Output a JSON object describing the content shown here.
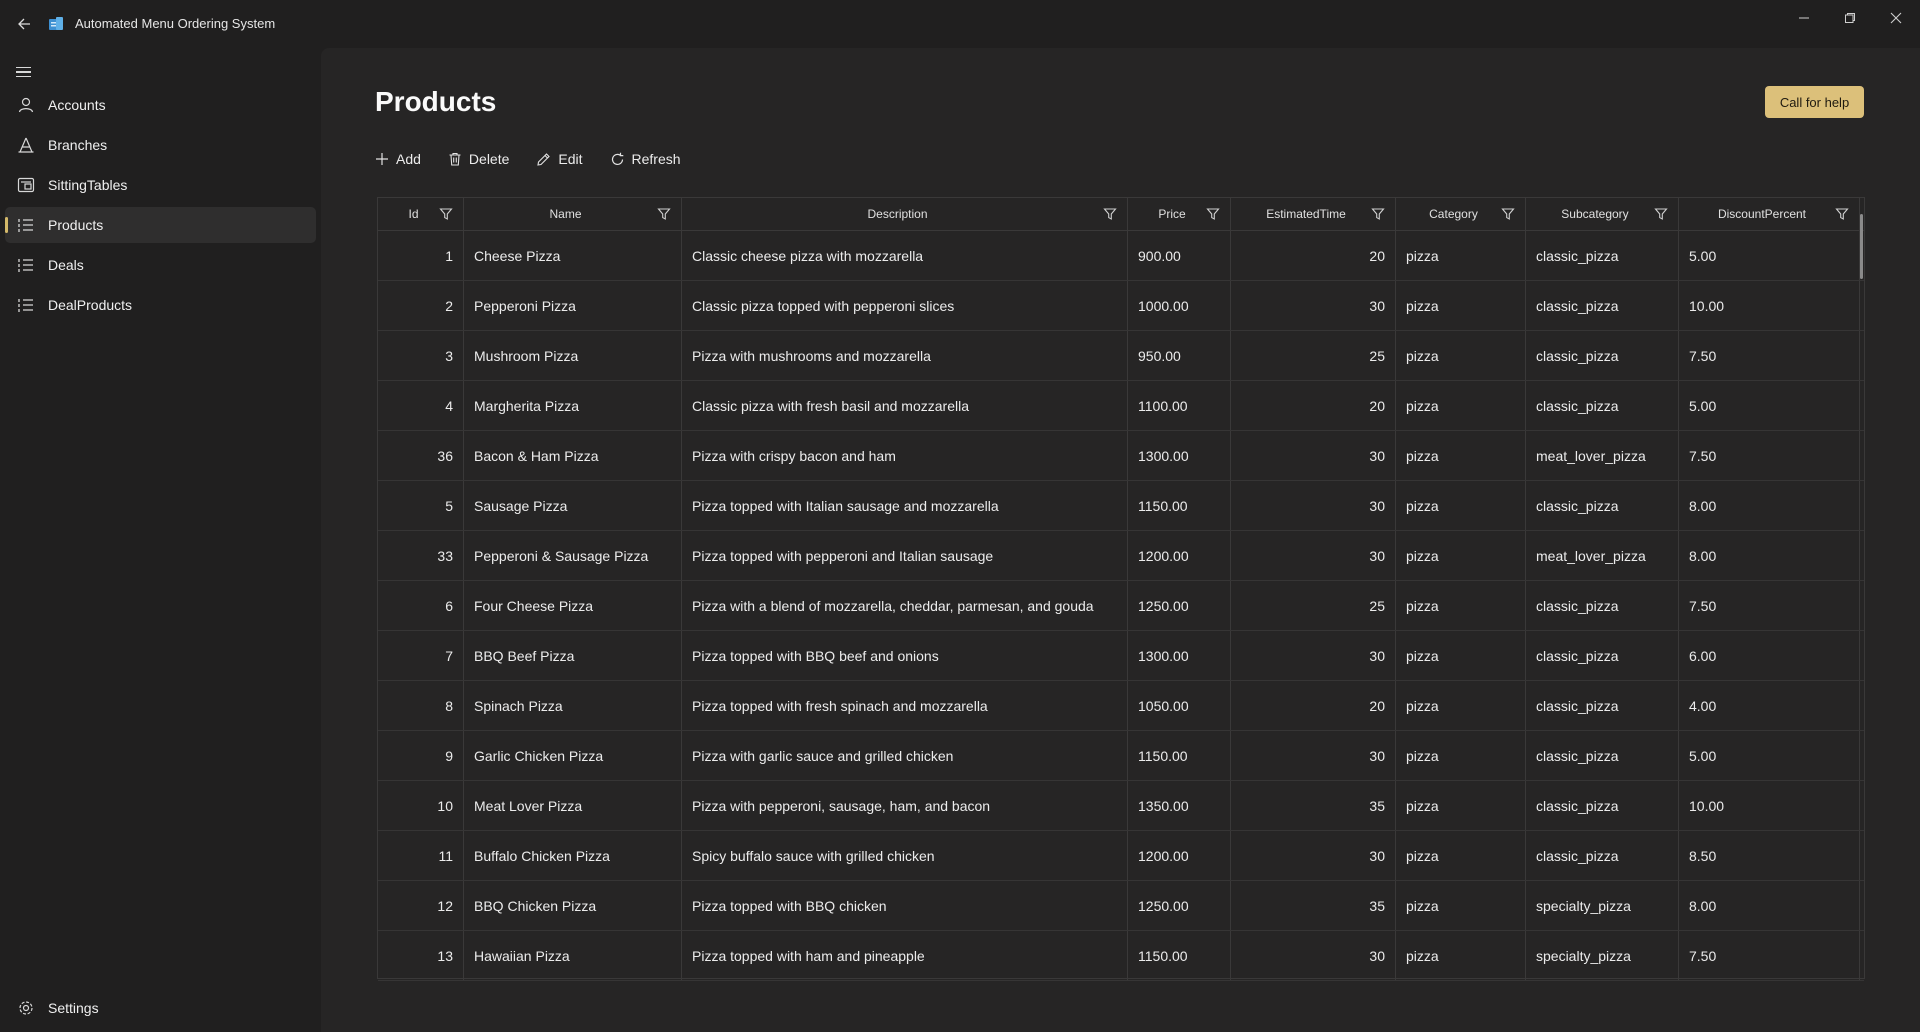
{
  "window": {
    "title": "Automated Menu Ordering System"
  },
  "sidebar": {
    "items": [
      {
        "label": "Accounts",
        "icon": "person-icon"
      },
      {
        "label": "Branches",
        "icon": "branch-icon"
      },
      {
        "label": "SittingTables",
        "icon": "table-icon"
      },
      {
        "label": "Products",
        "icon": "list-icon",
        "selected": true
      },
      {
        "label": "Deals",
        "icon": "list-icon"
      },
      {
        "label": "DealProducts",
        "icon": "list-icon"
      }
    ],
    "settings_label": "Settings"
  },
  "page": {
    "title": "Products",
    "help_label": "Call for help"
  },
  "toolbar": {
    "add_label": "Add",
    "delete_label": "Delete",
    "edit_label": "Edit",
    "refresh_label": "Refresh"
  },
  "table": {
    "columns": [
      "Id",
      "Name",
      "Description",
      "Price",
      "EstimatedTime",
      "Category",
      "Subcategory",
      "DiscountPercent"
    ],
    "rows": [
      {
        "id": "1",
        "name": "Cheese Pizza",
        "description": "Classic cheese pizza with mozzarella",
        "price": "900.00",
        "time": "20",
        "category": "pizza",
        "subcategory": "classic_pizza",
        "discount": "5.00"
      },
      {
        "id": "2",
        "name": "Pepperoni Pizza",
        "description": "Classic pizza topped with pepperoni slices",
        "price": "1000.00",
        "time": "30",
        "category": "pizza",
        "subcategory": "classic_pizza",
        "discount": "10.00"
      },
      {
        "id": "3",
        "name": "Mushroom Pizza",
        "description": "Pizza with mushrooms and mozzarella",
        "price": "950.00",
        "time": "25",
        "category": "pizza",
        "subcategory": "classic_pizza",
        "discount": "7.50"
      },
      {
        "id": "4",
        "name": "Margherita Pizza",
        "description": "Classic pizza with fresh basil and mozzarella",
        "price": "1100.00",
        "time": "20",
        "category": "pizza",
        "subcategory": "classic_pizza",
        "discount": "5.00"
      },
      {
        "id": "36",
        "name": "Bacon & Ham Pizza",
        "description": "Pizza with crispy bacon and ham",
        "price": "1300.00",
        "time": "30",
        "category": "pizza",
        "subcategory": "meat_lover_pizza",
        "discount": "7.50"
      },
      {
        "id": "5",
        "name": "Sausage Pizza",
        "description": "Pizza topped with Italian sausage and mozzarella",
        "price": "1150.00",
        "time": "30",
        "category": "pizza",
        "subcategory": "classic_pizza",
        "discount": "8.00"
      },
      {
        "id": "33",
        "name": "Pepperoni & Sausage Pizza",
        "description": "Pizza topped with pepperoni and Italian sausage",
        "price": "1200.00",
        "time": "30",
        "category": "pizza",
        "subcategory": "meat_lover_pizza",
        "discount": "8.00"
      },
      {
        "id": "6",
        "name": "Four Cheese Pizza",
        "description": "Pizza with a blend of mozzarella, cheddar, parmesan, and gouda",
        "price": "1250.00",
        "time": "25",
        "category": "pizza",
        "subcategory": "classic_pizza",
        "discount": "7.50"
      },
      {
        "id": "7",
        "name": "BBQ Beef Pizza",
        "description": "Pizza topped with BBQ beef and onions",
        "price": "1300.00",
        "time": "30",
        "category": "pizza",
        "subcategory": "classic_pizza",
        "discount": "6.00"
      },
      {
        "id": "8",
        "name": "Spinach Pizza",
        "description": "Pizza topped with fresh spinach and mozzarella",
        "price": "1050.00",
        "time": "20",
        "category": "pizza",
        "subcategory": "classic_pizza",
        "discount": "4.00"
      },
      {
        "id": "9",
        "name": "Garlic Chicken Pizza",
        "description": "Pizza with garlic sauce and grilled chicken",
        "price": "1150.00",
        "time": "30",
        "category": "pizza",
        "subcategory": "classic_pizza",
        "discount": "5.00"
      },
      {
        "id": "10",
        "name": "Meat Lover Pizza",
        "description": "Pizza with pepperoni, sausage, ham, and bacon",
        "price": "1350.00",
        "time": "35",
        "category": "pizza",
        "subcategory": "classic_pizza",
        "discount": "10.00"
      },
      {
        "id": "11",
        "name": "Buffalo Chicken Pizza",
        "description": "Spicy buffalo sauce with grilled chicken",
        "price": "1200.00",
        "time": "30",
        "category": "pizza",
        "subcategory": "classic_pizza",
        "discount": "8.50"
      },
      {
        "id": "12",
        "name": "BBQ Chicken Pizza",
        "description": "Pizza topped with BBQ chicken",
        "price": "1250.00",
        "time": "35",
        "category": "pizza",
        "subcategory": "specialty_pizza",
        "discount": "8.00"
      },
      {
        "id": "13",
        "name": "Hawaiian Pizza",
        "description": "Pizza topped with ham and pineapple",
        "price": "1150.00",
        "time": "30",
        "category": "pizza",
        "subcategory": "specialty_pizza",
        "discount": "7.50"
      }
    ]
  },
  "colors": {
    "accent": "#dcc07a",
    "background": "#201f1f",
    "content": "#262525"
  }
}
